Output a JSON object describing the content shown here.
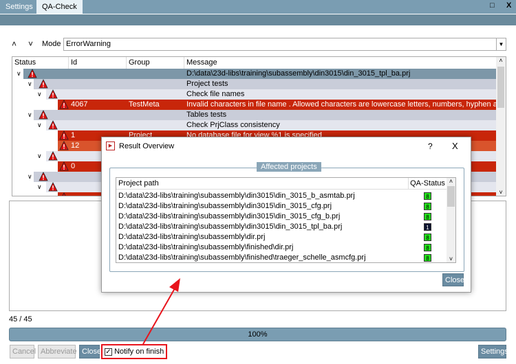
{
  "tabs": [
    {
      "label": "Settings"
    },
    {
      "label": "QA-Check"
    }
  ],
  "window_buttons": {
    "maximize": "□",
    "close": "X"
  },
  "toolbar": {
    "mode_label": "Mode",
    "mode_value": "ErrorWarning"
  },
  "tree": {
    "columns": [
      "Status",
      "Id",
      "Group",
      "Message"
    ],
    "rows": [
      {
        "level": 0,
        "id": "",
        "group": "",
        "message": "D:\\data\\23d-libs\\training\\subassembly\\din3015\\din_3015_tpl_ba.prj",
        "bg": "#7d97a8"
      },
      {
        "level": 1,
        "id": "",
        "group": "",
        "message": "Project tests",
        "bg": "#c9cdd9"
      },
      {
        "level": 2,
        "id": "",
        "group": "",
        "message": "Check file names",
        "bg": "#e4e6ee"
      },
      {
        "level": 3,
        "id": "4067",
        "group": "TestMeta",
        "message": "Invalid characters in file name . Allowed characters are lowercase letters, numbers, hyphen and und...",
        "bg": "#c8260a"
      },
      {
        "level": 1,
        "id": "",
        "group": "",
        "message": "Tables tests",
        "bg": "#c9cdd9"
      },
      {
        "level": 2,
        "id": "",
        "group": "",
        "message": "Check PrjClass consistency",
        "bg": "#e4e6ee"
      },
      {
        "level": 3,
        "id": "1",
        "group": "Project",
        "message": "No database file for view %1 is specified",
        "bg": "#c8260a"
      },
      {
        "level": 3,
        "id": "12",
        "group": "",
        "message": "",
        "bg": "#d9542c"
      },
      {
        "level": 2,
        "id": "",
        "group": "",
        "message": "",
        "bg": "#e4e6ee"
      },
      {
        "level": 3,
        "id": "0",
        "group": "",
        "message": "",
        "bg": "#c8260a"
      },
      {
        "level": 1,
        "id": "",
        "group": "",
        "message": "",
        "bg": "#c9cdd9"
      },
      {
        "level": 2,
        "id": "",
        "group": "",
        "message": "",
        "bg": "#e4e6ee"
      },
      {
        "level": 3,
        "id": "",
        "group": "",
        "message": "",
        "bg": "#c8260a"
      }
    ]
  },
  "counter": "45 / 45",
  "progress": {
    "label": "100%",
    "value": 100
  },
  "buttons": {
    "cancel": "Cancel",
    "abbreviate": "Abbreviate",
    "close": "Close",
    "notify": "Notify on finish",
    "settings": "Settings"
  },
  "notify_checked": true,
  "dialog": {
    "title": "Result Overview",
    "help": "?",
    "close_x": "X",
    "group_label": "Affected projects",
    "columns": [
      "Project path",
      "QA-Status"
    ],
    "rows": [
      {
        "path": "D:\\data\\23d-libs\\training\\subassembly\\din3015\\din_3015_b_asmtab.prj",
        "status": "8",
        "color": "#22e01a"
      },
      {
        "path": "D:\\data\\23d-libs\\training\\subassembly\\din3015\\din_3015_cfg.prj",
        "status": "8",
        "color": "#22e01a"
      },
      {
        "path": "D:\\data\\23d-libs\\training\\subassembly\\din3015\\din_3015_cfg_b.prj",
        "status": "8",
        "color": "#22e01a"
      },
      {
        "path": "D:\\data\\23d-libs\\training\\subassembly\\din3015\\din_3015_tpl_ba.prj",
        "status": "1",
        "color": "#0d1530"
      },
      {
        "path": "D:\\data\\23d-libs\\training\\subassembly\\dir.prj",
        "status": "8",
        "color": "#22e01a"
      },
      {
        "path": "D:\\data\\23d-libs\\training\\subassembly\\finished\\dir.prj",
        "status": "8",
        "color": "#22e01a"
      },
      {
        "path": "D:\\data\\23d-libs\\training\\subassembly\\finished\\traeger_schelle_asmcfg.prj",
        "status": "8",
        "color": "#22e01a"
      }
    ],
    "close_button": "Close"
  }
}
